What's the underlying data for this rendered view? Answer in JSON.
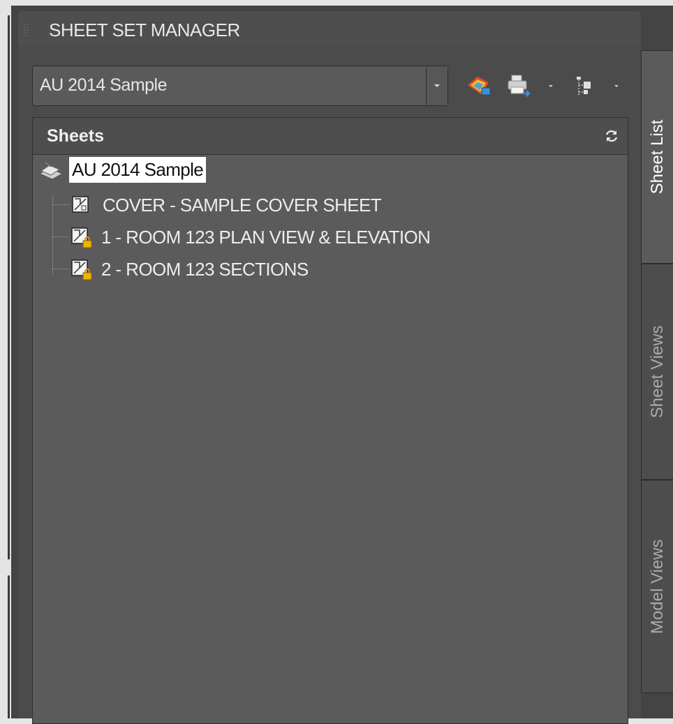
{
  "panel": {
    "title": "SHEET SET MANAGER"
  },
  "toolbar": {
    "sheet_set_select": {
      "value": "AU 2014 Sample"
    },
    "icons": [
      "sheet-set-icon",
      "publish-icon",
      "sheet-selections-icon"
    ]
  },
  "sheets": {
    "header": "Sheets",
    "root": {
      "label": "AU 2014 Sample",
      "icon": "sheet-set-icon"
    },
    "items": [
      {
        "label": "COVER - SAMPLE COVER SHEET",
        "icon": "sheet-icon",
        "locked": false
      },
      {
        "label": "1 - ROOM 123 PLAN VIEW & ELEVATION",
        "icon": "sheet-locked-icon",
        "locked": true
      },
      {
        "label": "2 - ROOM 123 SECTIONS",
        "icon": "sheet-locked-icon",
        "locked": true
      }
    ]
  },
  "tabs": [
    {
      "label": "Sheet List",
      "active": true
    },
    {
      "label": "Sheet Views",
      "active": false
    },
    {
      "label": "Model Views",
      "active": false
    }
  ],
  "colors": {
    "panel_bg": "#5b5b5b",
    "frame_bg": "#444444",
    "selection_bg": "#ffffff",
    "lock_color": "#f0b400"
  }
}
